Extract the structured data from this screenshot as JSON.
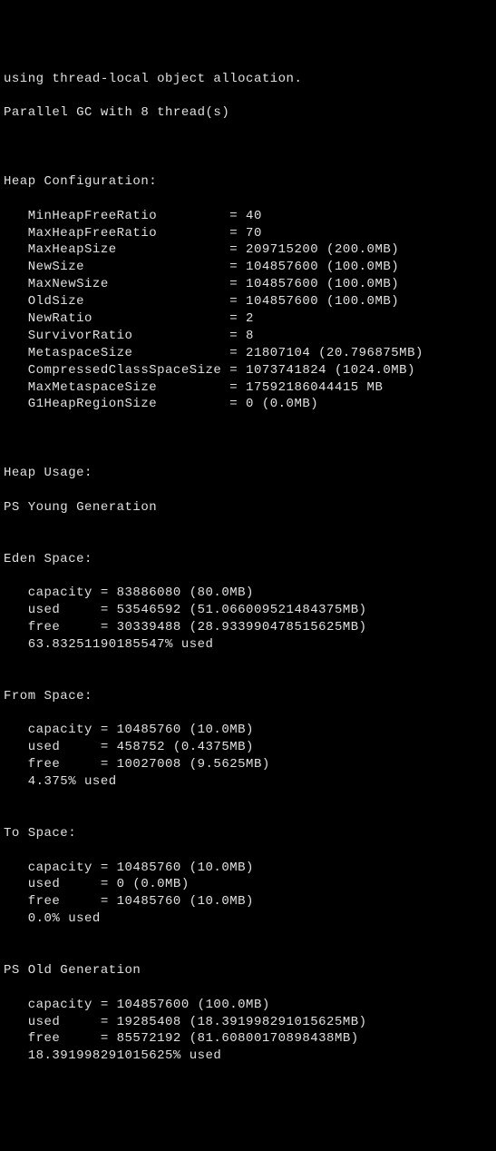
{
  "header": {
    "line1": "using thread-local object allocation.",
    "line2": "Parallel GC with 8 thread(s)"
  },
  "heap_config": {
    "title": "Heap Configuration:",
    "rows": [
      {
        "key": "MinHeapFreeRatio",
        "value": "40"
      },
      {
        "key": "MaxHeapFreeRatio",
        "value": "70"
      },
      {
        "key": "MaxHeapSize",
        "value": "209715200 (200.0MB)"
      },
      {
        "key": "NewSize",
        "value": "104857600 (100.0MB)"
      },
      {
        "key": "MaxNewSize",
        "value": "104857600 (100.0MB)"
      },
      {
        "key": "OldSize",
        "value": "104857600 (100.0MB)"
      },
      {
        "key": "NewRatio",
        "value": "2"
      },
      {
        "key": "SurvivorRatio",
        "value": "8"
      },
      {
        "key": "MetaspaceSize",
        "value": "21807104 (20.796875MB)"
      },
      {
        "key": "CompressedClassSpaceSize",
        "value": "1073741824 (1024.0MB)"
      },
      {
        "key": "MaxMetaspaceSize",
        "value": "17592186044415 MB"
      },
      {
        "key": "G1HeapRegionSize",
        "value": "0 (0.0MB)"
      }
    ]
  },
  "heap_usage": {
    "title": "Heap Usage:",
    "young_gen": "PS Young Generation",
    "eden": {
      "title": "Eden Space:",
      "capacity": "83886080 (80.0MB)",
      "used": "53546592 (51.066009521484375MB)",
      "free": "30339488 (28.933990478515625MB)",
      "pct": "63.83251190185547% used"
    },
    "from": {
      "title": "From Space:",
      "capacity": "10485760 (10.0MB)",
      "used": "458752 (0.4375MB)",
      "free": "10027008 (9.5625MB)",
      "pct": "4.375% used"
    },
    "to": {
      "title": "To Space:",
      "capacity": "10485760 (10.0MB)",
      "used": "0 (0.0MB)",
      "free": "10485760 (10.0MB)",
      "pct": "0.0% used"
    },
    "old_gen": {
      "title": "PS Old Generation",
      "capacity": "104857600 (100.0MB)",
      "used": "19285408 (18.391998291015625MB)",
      "free": "85572192 (81.60800170898438MB)",
      "pct": "18.391998291015625% used"
    }
  },
  "labels": {
    "capacity": "capacity",
    "used": "used",
    "free": "free"
  }
}
